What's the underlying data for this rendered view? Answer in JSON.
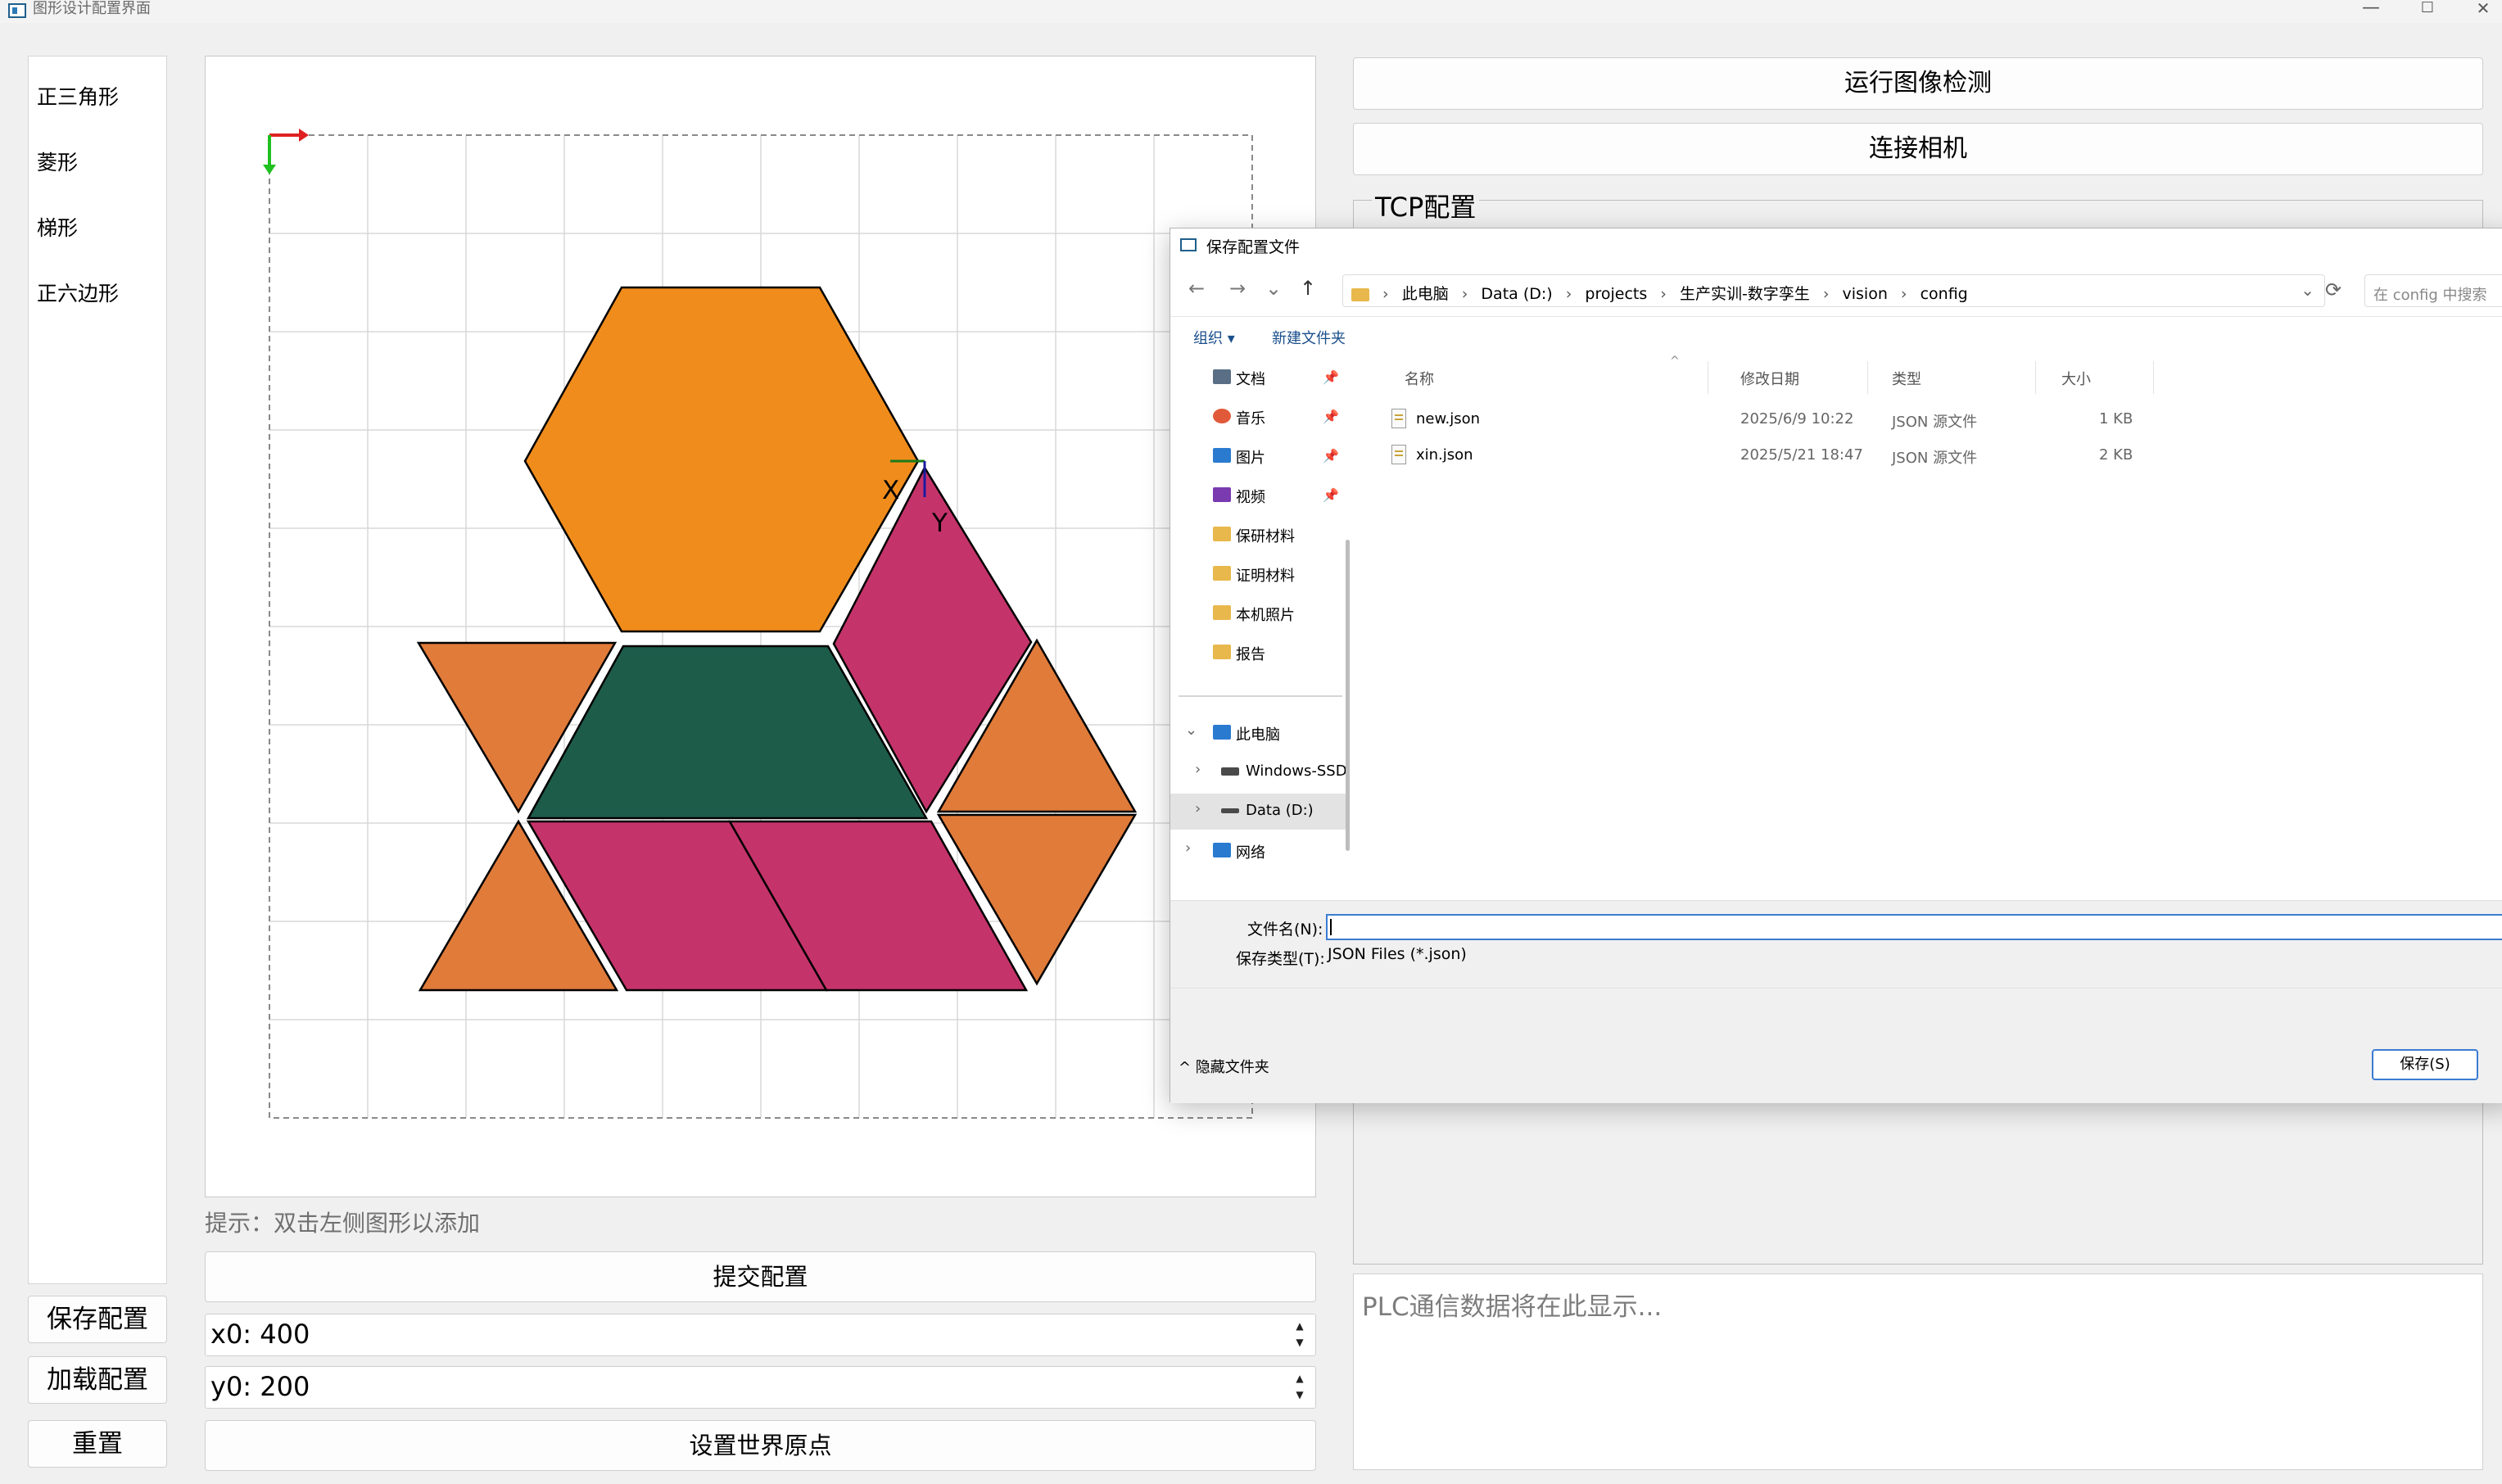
{
  "window": {
    "title": "图形设计配置界面",
    "minimize_glyph": "—",
    "maximize_glyph": "☐",
    "close_glyph": "✕"
  },
  "shape_list": {
    "items": [
      {
        "label": "正三角形"
      },
      {
        "label": "菱形"
      },
      {
        "label": "梯形"
      },
      {
        "label": "正六边形"
      }
    ]
  },
  "left_buttons": {
    "save": "保存配置",
    "load": "加载配置",
    "reset": "重置"
  },
  "canvas": {
    "axis_x_label": "X",
    "axis_y_label": "Y",
    "shapes": [
      {
        "type": "hexagon",
        "color": "#f08c1c"
      },
      {
        "type": "rhombus",
        "color": "#c5336b"
      },
      {
        "type": "trapezoid",
        "color": "#1e5c4a"
      },
      {
        "type": "triangle",
        "color": "#e07b3a"
      },
      {
        "type": "triangle",
        "color": "#e07b3a"
      },
      {
        "type": "triangle",
        "color": "#e07b3a"
      },
      {
        "type": "triangle",
        "color": "#e07b3a"
      },
      {
        "type": "rhombus",
        "color": "#c5336b"
      },
      {
        "type": "rhombus",
        "color": "#c5336b"
      }
    ]
  },
  "hint": "提示：双击左侧图形以添加",
  "submit_button": "提交配置",
  "x0_field": {
    "value": "x0: 400",
    "up": "▲",
    "down": "▼"
  },
  "y0_field": {
    "value": "y0: 200",
    "up": "▲",
    "down": "▼"
  },
  "set_origin_button": "设置世界原点",
  "right_panel": {
    "run_detection_button": "运行图像检测",
    "connect_camera_button": "连接相机",
    "tcp_title": "TCP配置",
    "plc_placeholder": "PLC通信数据将在此显示..."
  },
  "dialog": {
    "title": "保存配置文件",
    "nav": {
      "back": "←",
      "forward": "→",
      "recent": "⌄",
      "up": "↑",
      "refresh": "⟳",
      "dropdown": "⌄"
    },
    "breadcrumbs": [
      "此电脑",
      "Data (D:)",
      "projects",
      "生产实训-数字孪生",
      "vision",
      "config"
    ],
    "breadcrumb_sep": "›",
    "search_placeholder": "在 config 中搜索",
    "toolbar": {
      "organize": "组织 ▾",
      "new_folder": "新建文件夹"
    },
    "nav_pane": [
      {
        "label": "文档",
        "pinned": true,
        "icon": "documents-icon",
        "color": "#5a6f86"
      },
      {
        "label": "音乐",
        "pinned": true,
        "icon": "music-icon",
        "color": "#e05a3a"
      },
      {
        "label": "图片",
        "pinned": true,
        "icon": "pictures-icon",
        "color": "#2a7ad0"
      },
      {
        "label": "视频",
        "pinned": true,
        "icon": "videos-icon",
        "color": "#7a3ab0"
      },
      {
        "label": "保研材料",
        "pinned": false,
        "icon": "folder-icon",
        "color": "#e8b84c"
      },
      {
        "label": "证明材料",
        "pinned": false,
        "icon": "folder-icon",
        "color": "#e8b84c"
      },
      {
        "label": "本机照片",
        "pinned": false,
        "icon": "folder-icon",
        "color": "#e8b84c"
      },
      {
        "label": "报告",
        "pinned": false,
        "icon": "folder-icon",
        "color": "#e8b84c"
      }
    ],
    "nav_tree": [
      {
        "label": "此电脑",
        "expander": "⌄",
        "icon": "pc-icon",
        "color": "#2a7ad0"
      },
      {
        "label": "Windows-SSD",
        "expander": "›",
        "icon": "drive-icon",
        "color": "#4a4a4a"
      },
      {
        "label": "Data (D:)",
        "expander": "›",
        "icon": "drive-icon",
        "color": "#4a4a4a",
        "selected": true
      },
      {
        "label": "网络",
        "expander": "›",
        "icon": "network-icon",
        "color": "#2a7ad0"
      }
    ],
    "pin_glyph": "📌",
    "columns": {
      "name": "名称",
      "modified": "修改日期",
      "type": "类型",
      "size": "大小",
      "sort_glyph": "^"
    },
    "files": [
      {
        "name": "new.json",
        "modified": "2025/6/9 10:22",
        "type": "JSON 源文件",
        "size": "1 KB"
      },
      {
        "name": "xin.json",
        "modified": "2025/5/21 18:47",
        "type": "JSON 源文件",
        "size": "2 KB"
      }
    ],
    "filename_label": "文件名(N):",
    "filename_value": "",
    "filetype_label": "保存类型(T):",
    "filetype_value": "JSON Files (*.json)",
    "hide_folders": "^ 隐藏文件夹",
    "save_button": "保存(S)"
  }
}
